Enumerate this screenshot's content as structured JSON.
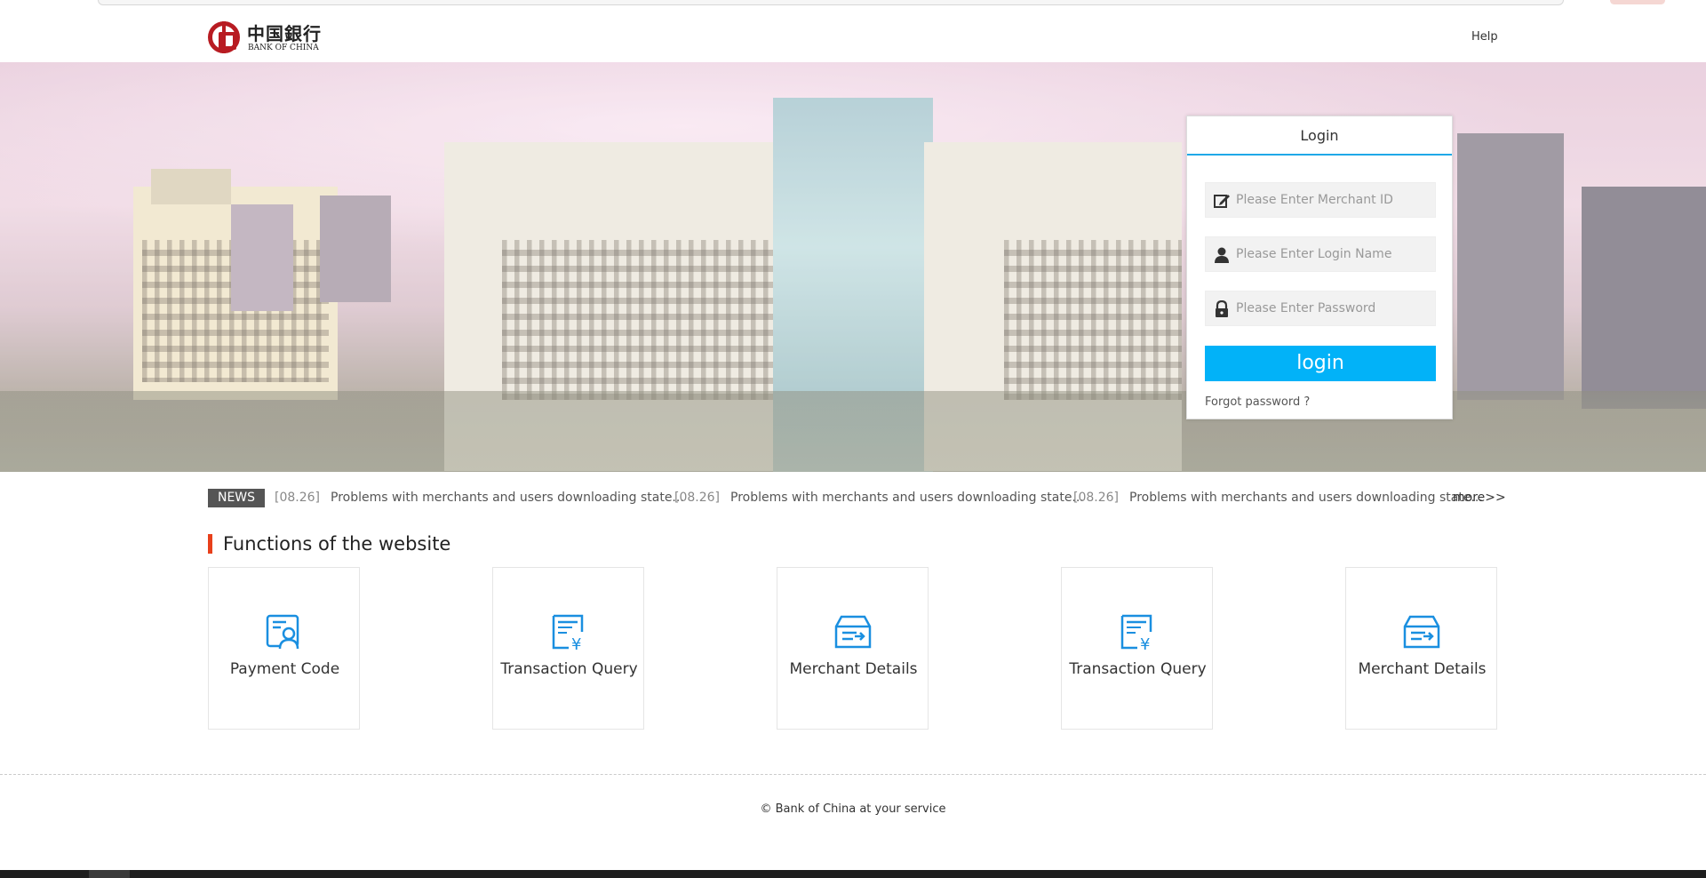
{
  "header": {
    "logo_cn": "中国銀行",
    "logo_en": "BANK OF CHINA",
    "help_label": "Help"
  },
  "login": {
    "title": "Login",
    "merchant_id_placeholder": "Please Enter Merchant ID",
    "login_name_placeholder": "Please Enter Login Name",
    "password_placeholder": "Please Enter Password",
    "button_label": "login",
    "forgot_label": "Forgot password ?",
    "accent_color": "#02b2f8"
  },
  "news": {
    "badge": "NEWS",
    "items": [
      {
        "date": "[08.26]",
        "title": "Problems with merchants and users downloading state..."
      },
      {
        "date": "[08.26]",
        "title": "Problems with merchants and users downloading state..."
      },
      {
        "date": "[08.26]",
        "title": "Problems with merchants and users downloading state..."
      }
    ],
    "more_label": "more>>"
  },
  "functions": {
    "title": "Functions of the website",
    "cards": [
      {
        "label": "Payment Code",
        "icon": "payment-code-icon"
      },
      {
        "label": "Transaction Query",
        "icon": "transaction-query-icon"
      },
      {
        "label": "Merchant Details",
        "icon": "merchant-details-icon"
      },
      {
        "label": "Transaction Query",
        "icon": "transaction-query-icon"
      },
      {
        "label": "Merchant Details",
        "icon": "merchant-details-icon"
      }
    ]
  },
  "footer": {
    "copyright": "© Bank of China at your service"
  },
  "colors": {
    "brand_red": "#b81c22",
    "section_accent": "#e8401b",
    "icon_blue": "#1a8fe0"
  }
}
